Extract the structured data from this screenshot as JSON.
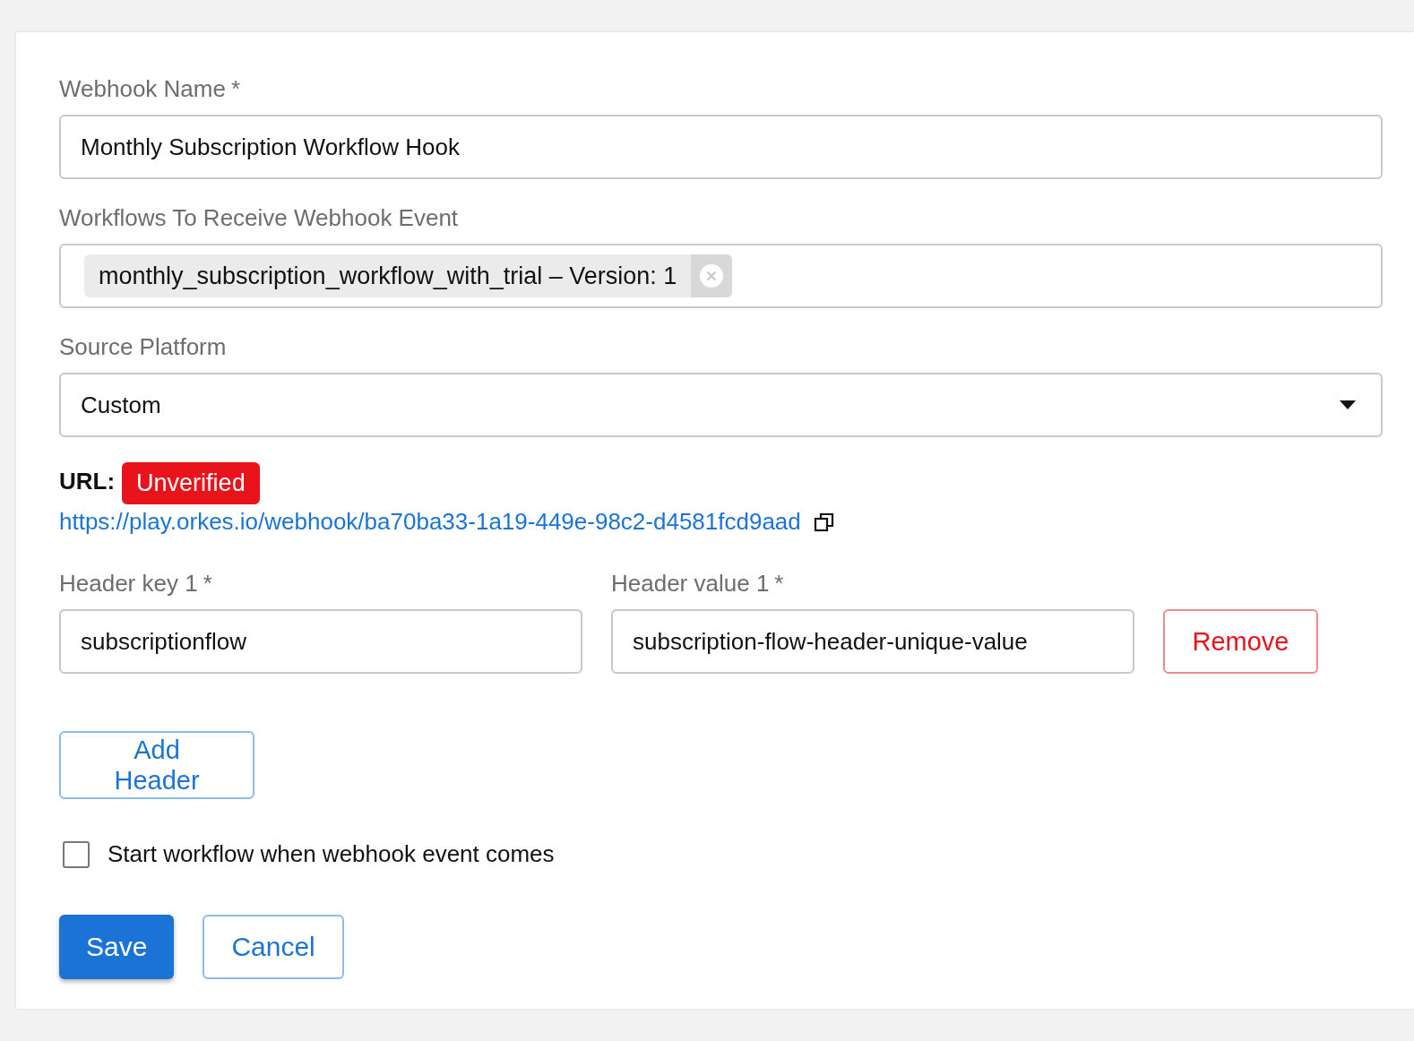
{
  "form": {
    "name_field": {
      "label": "Webhook Name",
      "required_mark": "*",
      "value": "Monthly Subscription Workflow Hook"
    },
    "workflows_field": {
      "label": "Workflows To Receive Webhook Event",
      "chips": [
        {
          "label": "monthly_subscription_workflow_with_trial – Version: 1"
        }
      ]
    },
    "platform_field": {
      "label": "Source Platform",
      "value": "Custom"
    },
    "url": {
      "label": "URL:",
      "status": "Unverified",
      "link": "https://play.orkes.io/webhook/ba70ba33-1a19-449e-98c2-d4581fcd9aad"
    },
    "headers": [
      {
        "key_label": "Header key 1",
        "key_required": "*",
        "key_value": "subscriptionflow",
        "value_label": "Header value 1",
        "value_required": "*",
        "value": "subscription-flow-header-unique-value",
        "remove": "Remove"
      }
    ],
    "add_header": "Add Header",
    "start_checkbox": {
      "label": "Start workflow when webhook event comes",
      "checked": false
    },
    "buttons": [
      {
        "label": "Save",
        "kind": "primary"
      },
      {
        "label": "Cancel",
        "kind": "secondary"
      }
    ]
  }
}
